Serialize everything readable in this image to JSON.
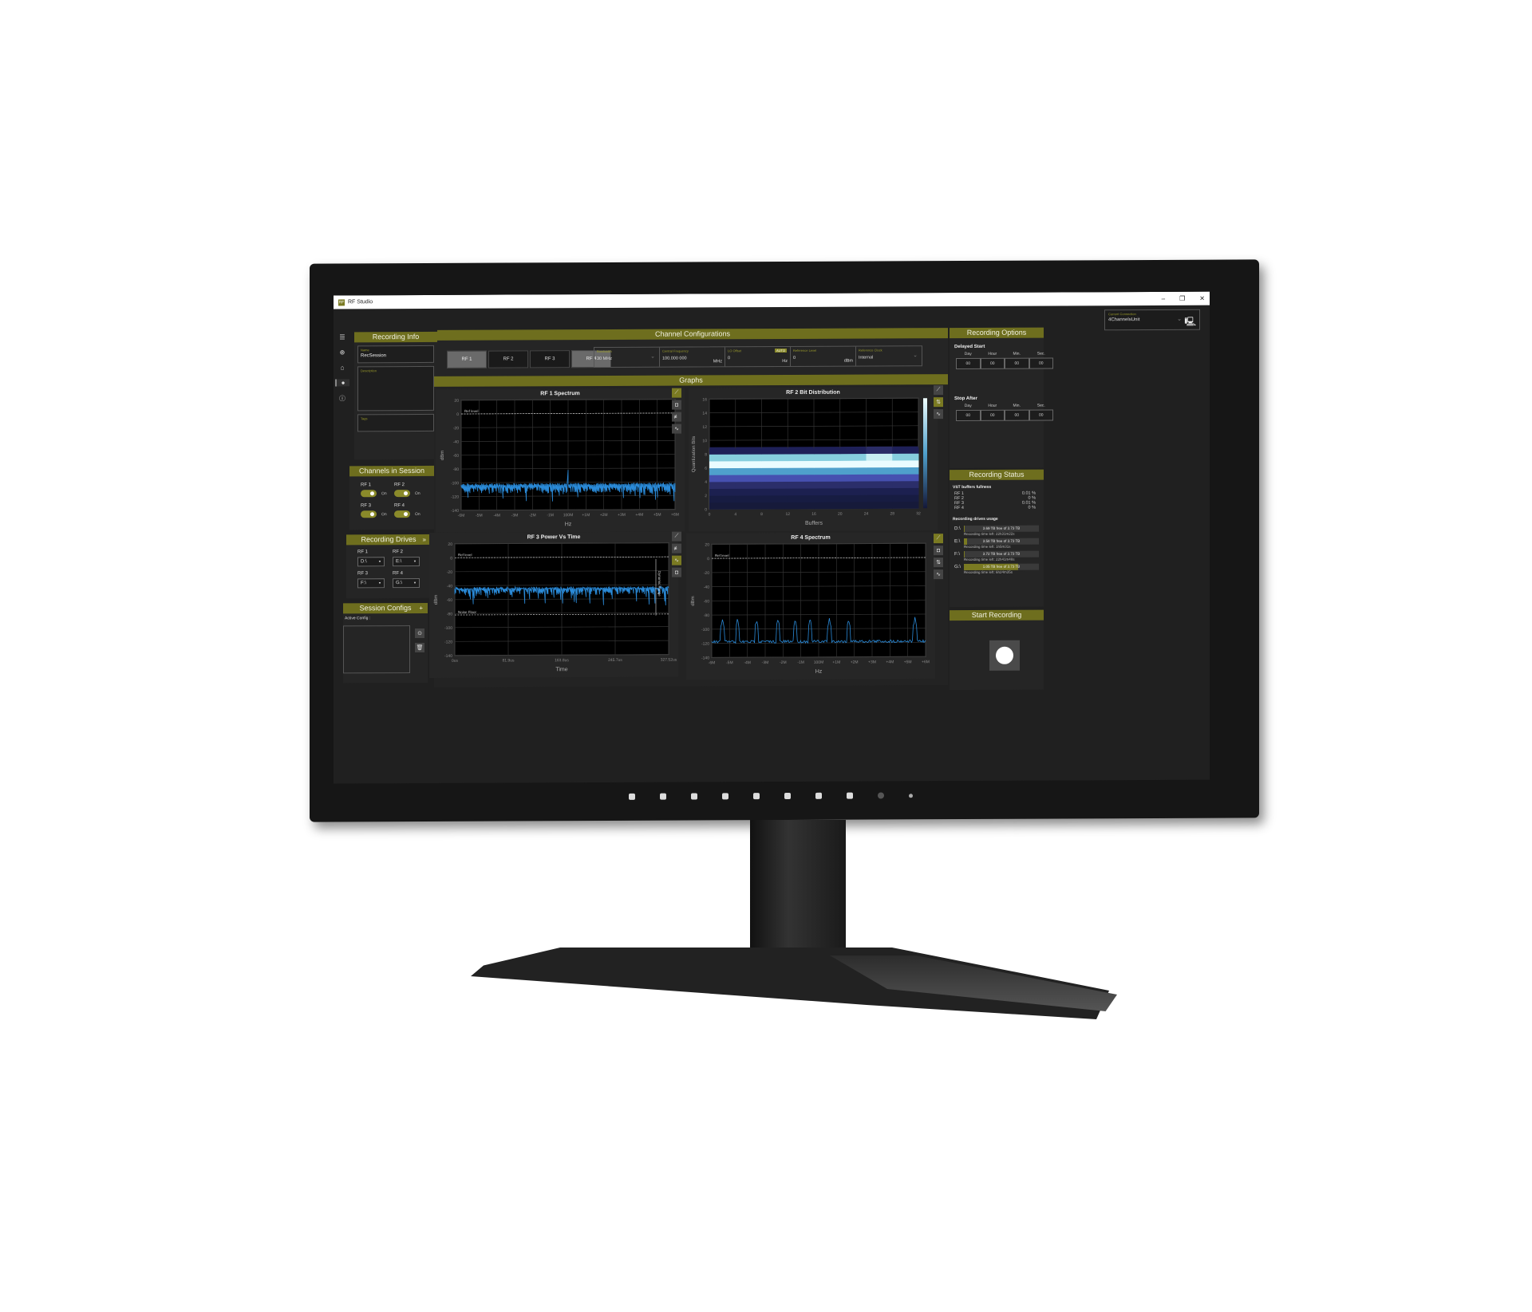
{
  "window": {
    "app_title": "RF Studio",
    "controls": [
      "–",
      "❐",
      "✕"
    ]
  },
  "connection": {
    "label": "Current Connection",
    "value": "4ChannelsUnit"
  },
  "nav": {
    "icons": [
      "menu-icon",
      "globe-icon",
      "home-icon",
      "record-icon",
      "info-icon"
    ]
  },
  "recording_info": {
    "header": "Recording Info",
    "name": {
      "label": "Name",
      "value": "RecSession"
    },
    "description": {
      "label": "Description",
      "value": ""
    },
    "tags": {
      "label": "Tags",
      "value": ""
    }
  },
  "channels_in_session": {
    "header": "Channels in Session",
    "items": [
      {
        "name": "RF 1",
        "state": "On"
      },
      {
        "name": "RF 2",
        "state": "On"
      },
      {
        "name": "RF 3",
        "state": "On"
      },
      {
        "name": "RF 4",
        "state": "On"
      }
    ]
  },
  "recording_drives": {
    "header": "Recording Drives",
    "expand": "»",
    "items": [
      {
        "name": "RF 1",
        "drive": "D:\\"
      },
      {
        "name": "RF 2",
        "drive": "E:\\"
      },
      {
        "name": "RF 3",
        "drive": "F:\\"
      },
      {
        "name": "RF 4",
        "drive": "G:\\"
      }
    ]
  },
  "session_configs": {
    "header": "Session Configs",
    "add": "+",
    "active_label": "Active Config :"
  },
  "channel_config": {
    "header": "Channel Configurations",
    "tabs": [
      "RF 1",
      "RF 2",
      "RF 3",
      "RF 4"
    ],
    "bandwidth": {
      "label": "Bandwidth",
      "value": "30 MHz"
    },
    "center_frequency": {
      "label": "Central Frequency",
      "value": "100.000 000",
      "unit": "MHz"
    },
    "lo_offset": {
      "label": "LO Offset",
      "value": "0",
      "unit": "Hz",
      "auto": "AUTO"
    },
    "reference_level": {
      "label": "Reference Level",
      "value": "0",
      "unit": "dBm"
    },
    "reference_clock": {
      "label": "Reference Clock",
      "value": "Internal"
    }
  },
  "graphs": {
    "header": "Graphs",
    "rf1": {
      "title": "RF 1 Spectrum",
      "ylabel": "dBm",
      "xlabel": "Hz",
      "ref_label": "Ref level",
      "yticks": [
        "20",
        "0",
        "-20",
        "-40",
        "-60",
        "-80",
        "-100",
        "-120",
        "-140"
      ],
      "xticks": [
        "-6M",
        "-5M",
        "-4M",
        "-3M",
        "-2M",
        "-1M",
        "100M",
        "+1M",
        "+2M",
        "+3M",
        "+4M",
        "+5M",
        "+6M"
      ]
    },
    "rf2": {
      "title": "RF 2 Bit Distribution",
      "ylabel": "Quantization Bits",
      "xlabel": "Buffers",
      "yticks": [
        "16",
        "14",
        "12",
        "10",
        "8",
        "6",
        "4",
        "2",
        "0"
      ],
      "xticks": [
        "0",
        "4",
        "8",
        "12",
        "16",
        "20",
        "24",
        "28",
        "32"
      ]
    },
    "rf3": {
      "title": "RF 3 Power Vs Time",
      "ylabel": "dBm",
      "xlabel": "Time",
      "ref_label": "Ref level",
      "noise_label": "Noise Floor",
      "range_label": "Dynamic Range",
      "yticks": [
        "20",
        "0",
        "-20",
        "-40",
        "-60",
        "-80",
        "-100",
        "-120",
        "-140"
      ],
      "xticks": [
        "0us",
        "81.9us",
        "163.8us",
        "245.7us",
        "327.52us"
      ]
    },
    "rf4": {
      "title": "RF 4 Spectrum",
      "ylabel": "dBm",
      "xlabel": "Hz",
      "ref_label": "Ref level",
      "yticks": [
        "20",
        "0",
        "-20",
        "-40",
        "-60",
        "-80",
        "-100",
        "-120",
        "-140"
      ],
      "xticks": [
        "-6M",
        "-5M",
        "-4M",
        "-3M",
        "-2M",
        "-1M",
        "100M",
        "+1M",
        "+2M",
        "+3M",
        "+4M",
        "+5M",
        "+6M"
      ]
    }
  },
  "recording_options": {
    "header": "Recording Options",
    "delayed_start": {
      "label": "Delayed Start",
      "cols": [
        "Day",
        "Hour",
        "Min.",
        "Sec."
      ],
      "values": [
        "00",
        "00",
        "00",
        "00"
      ]
    },
    "stop_after": {
      "label": "Stop After",
      "cols": [
        "Day",
        "Hour",
        "Min.",
        "Sec."
      ],
      "values": [
        "00",
        "00",
        "00",
        "00"
      ]
    }
  },
  "recording_status": {
    "header": "Recording Status",
    "vst_label": "VST buffers fullness",
    "vst": [
      {
        "name": "RF 1",
        "value": "0.01 %"
      },
      {
        "name": "RF 2",
        "value": "0 %"
      },
      {
        "name": "RF 3",
        "value": "0.01 %"
      },
      {
        "name": "RF 4",
        "value": "0 %"
      }
    ],
    "drives_label": "Recording drives usage",
    "drives": [
      {
        "drive": "D:\\",
        "text": "3.69 TB free of 3.73 TB",
        "used_fraction": 0.011,
        "time_left": "Recording time left: 22h31m22s"
      },
      {
        "drive": "E:\\",
        "text": "3.58 TB free of 3.73 TB",
        "used_fraction": 0.04,
        "time_left": "Recording time left: 1h5m31s"
      },
      {
        "drive": "F:\\",
        "text": "3.72 TB free of 3.73 TB",
        "used_fraction": 0.003,
        "time_left": "Recording time left: 22h41m48s"
      },
      {
        "drive": "G:\\",
        "text": "1.05 TB free of 3.73 TB",
        "used_fraction": 0.72,
        "time_left": "Recording time left: 6h24m35s"
      }
    ]
  },
  "start_recording": {
    "header": "Start Recording"
  }
}
